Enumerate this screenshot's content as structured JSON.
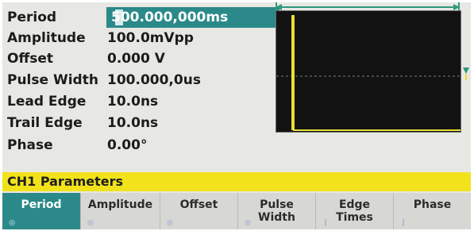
{
  "params": [
    {
      "label": "Period",
      "value": "500.000,000ms"
    },
    {
      "label": "Amplitude",
      "value": "100.0mVpp"
    },
    {
      "label": "Offset",
      "value": "0.000 V"
    },
    {
      "label": "Pulse Width",
      "value": "100.000,0us"
    },
    {
      "label": "Lead Edge",
      "value": "10.0ns"
    },
    {
      "label": "Trail Edge",
      "value": "10.0ns"
    },
    {
      "label": "Phase",
      "value": "0.00°"
    }
  ],
  "status": {
    "text": "CH1  Parameters"
  },
  "softkeys": [
    {
      "label": "Period",
      "active": true
    },
    {
      "label": "Amplitude",
      "active": false
    },
    {
      "label": "Offset",
      "active": false
    },
    {
      "label": "Pulse\nWidth",
      "active": false
    },
    {
      "label": "Edge\nTimes",
      "active": false
    },
    {
      "label": "Phase",
      "active": false
    }
  ],
  "colors": {
    "accent": "#2b8a89",
    "status_bar": "#f2e21b",
    "trace": "#e9e032",
    "marker": "#2f9a7a"
  }
}
